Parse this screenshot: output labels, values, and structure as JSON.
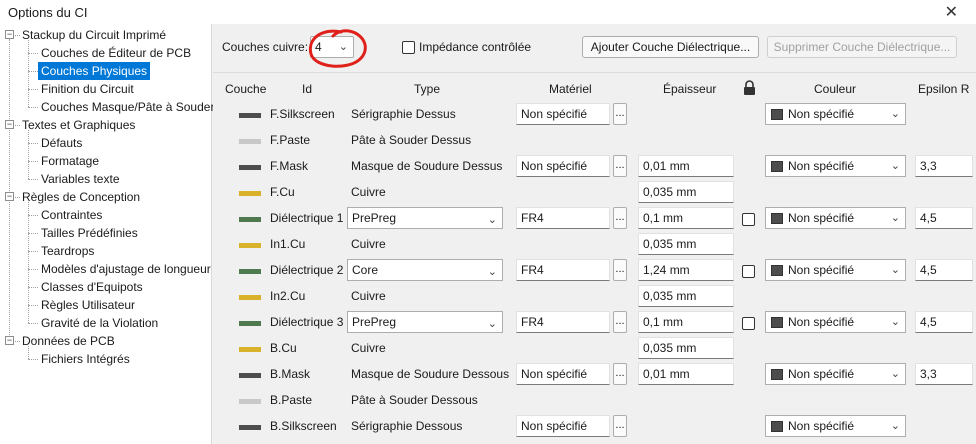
{
  "window": {
    "title": "Options du CI",
    "close_glyph": "✕"
  },
  "sidebar": {
    "items": [
      {
        "label": "Stackup du Circuit Imprimé",
        "level": 0,
        "toggle": "−"
      },
      {
        "label": "Couches de Éditeur de PCB",
        "level": 1
      },
      {
        "label": "Couches Physiques",
        "level": 1,
        "selected": true
      },
      {
        "label": "Finition du Circuit",
        "level": 1
      },
      {
        "label": "Couches Masque/Pâte à Souder",
        "level": 1
      },
      {
        "label": "Textes et Graphiques",
        "level": 0,
        "toggle": "−"
      },
      {
        "label": "Défauts",
        "level": 1
      },
      {
        "label": "Formatage",
        "level": 1
      },
      {
        "label": "Variables texte",
        "level": 1
      },
      {
        "label": "Règles de Conception",
        "level": 0,
        "toggle": "−"
      },
      {
        "label": "Contraintes",
        "level": 1
      },
      {
        "label": "Tailles Prédéfinies",
        "level": 1
      },
      {
        "label": "Teardrops",
        "level": 1
      },
      {
        "label": "Modèles d'ajustage de longueur",
        "level": 1
      },
      {
        "label": "Classes d'Equipots",
        "level": 1
      },
      {
        "label": "Règles Utilisateur",
        "level": 1
      },
      {
        "label": "Gravité de la Violation",
        "level": 1
      },
      {
        "label": "Données de PCB",
        "level": 0,
        "toggle": "−"
      },
      {
        "label": "Fichiers Intégrés",
        "level": 1
      }
    ]
  },
  "controls": {
    "copper_layers_label": "Couches cuivre:",
    "copper_layers_value": "4",
    "controlled_impedance_label": "Impédance contrôlée",
    "add_dielectric_button": "Ajouter Couche Diélectrique...",
    "remove_dielectric_button": "Supprimer Couche Diélectrique..."
  },
  "columns": {
    "couche": "Couche",
    "id": "Id",
    "type": "Type",
    "materiel": "Matériel",
    "epaisseur": "Épaisseur",
    "couleur": "Couleur",
    "epsilon": "Epsilon R"
  },
  "colors": {
    "silkscreen": "#4d4d4d",
    "paste": "#c8c8c8",
    "mask": "#4d4d4d",
    "copper": "#d9b12a",
    "dielectric": "#4f7a4f",
    "selection": "#0078d7",
    "annotation": "#e0201a"
  },
  "layers": [
    {
      "id": "F.Silkscreen",
      "swatch": "silkscreen",
      "type": "Sérigraphie Dessus",
      "material": "Non spécifié",
      "thickness": "",
      "color": "Non spécifié",
      "epsilon": ""
    },
    {
      "id": "F.Paste",
      "swatch": "paste",
      "type": "Pâte à Souder Dessus",
      "material": "",
      "thickness": "",
      "color": "",
      "epsilon": ""
    },
    {
      "id": "F.Mask",
      "swatch": "mask",
      "type": "Masque de Soudure Dessus",
      "material": "Non spécifié",
      "thickness": "0,01 mm",
      "color": "Non spécifié",
      "epsilon": "3,3"
    },
    {
      "id": "F.Cu",
      "swatch": "copper",
      "type": "Cuivre",
      "material": "",
      "thickness": "0,035 mm",
      "color": "",
      "epsilon": ""
    },
    {
      "id": "Diélectrique 1",
      "swatch": "dielectric",
      "type": "PrePreg",
      "type_is_select": true,
      "material": "FR4",
      "thickness": "0,1 mm",
      "has_lock": true,
      "color": "Non spécifié",
      "epsilon": "4,5"
    },
    {
      "id": "In1.Cu",
      "swatch": "copper",
      "type": "Cuivre",
      "material": "",
      "thickness": "0,035 mm",
      "color": "",
      "epsilon": ""
    },
    {
      "id": "Diélectrique 2",
      "swatch": "dielectric",
      "type": "Core",
      "type_is_select": true,
      "material": "FR4",
      "thickness": "1,24 mm",
      "has_lock": true,
      "color": "Non spécifié",
      "epsilon": "4,5"
    },
    {
      "id": "In2.Cu",
      "swatch": "copper",
      "type": "Cuivre",
      "material": "",
      "thickness": "0,035 mm",
      "color": "",
      "epsilon": ""
    },
    {
      "id": "Diélectrique 3",
      "swatch": "dielectric",
      "type": "PrePreg",
      "type_is_select": true,
      "material": "FR4",
      "thickness": "0,1 mm",
      "has_lock": true,
      "color": "Non spécifié",
      "epsilon": "4,5"
    },
    {
      "id": "B.Cu",
      "swatch": "copper",
      "type": "Cuivre",
      "material": "",
      "thickness": "0,035 mm",
      "color": "",
      "epsilon": ""
    },
    {
      "id": "B.Mask",
      "swatch": "mask",
      "type": "Masque de Soudure Dessous",
      "material": "Non spécifié",
      "thickness": "0,01 mm",
      "color": "Non spécifié",
      "epsilon": "3,3"
    },
    {
      "id": "B.Paste",
      "swatch": "paste",
      "type": "Pâte à Souder Dessous",
      "material": "",
      "thickness": "",
      "color": "",
      "epsilon": ""
    },
    {
      "id": "B.Silkscreen",
      "swatch": "silkscreen",
      "type": "Sérigraphie Dessous",
      "material": "Non spécifié",
      "thickness": "",
      "color": "Non spécifié",
      "epsilon": ""
    }
  ]
}
